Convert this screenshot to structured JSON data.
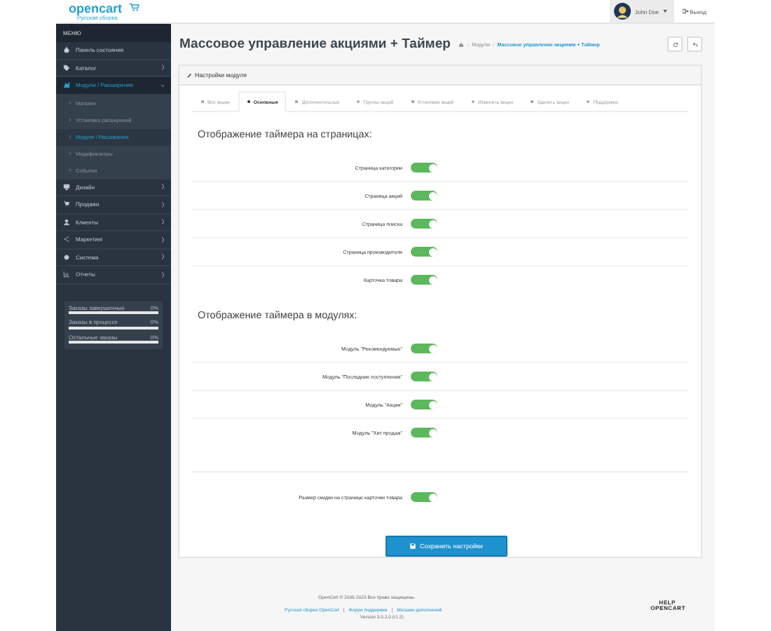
{
  "header": {
    "logo": "opencart",
    "logo_subtitle": "Русская сборка",
    "user": "John Doe",
    "logout": "Выход"
  },
  "sidebar": {
    "title": "МЕНЮ",
    "items": [
      {
        "label": "Панель состояния",
        "selected": false
      },
      {
        "label": "Каталог",
        "selected": false,
        "expanded": false
      },
      {
        "label": "Модули / Расширения",
        "selected": true,
        "expanded": true,
        "children": [
          {
            "label": "Магазин",
            "selected": false
          },
          {
            "label": "Установка расширений",
            "selected": false
          },
          {
            "label": "Модули / Расширения",
            "selected": true
          },
          {
            "label": "Модификаторы",
            "selected": false
          },
          {
            "label": "События",
            "selected": false
          }
        ]
      },
      {
        "label": "Дизайн",
        "selected": false,
        "expanded": false
      },
      {
        "label": "Продажи",
        "selected": false,
        "expanded": false
      },
      {
        "label": "Клиенты",
        "selected": false,
        "expanded": false
      },
      {
        "label": "Маркетинг",
        "selected": false,
        "expanded": false
      },
      {
        "label": "Система",
        "selected": false,
        "expanded": false
      },
      {
        "label": "Отчеты",
        "selected": false,
        "expanded": false
      }
    ],
    "stats": [
      {
        "label": "Заказы завершенные",
        "reading": "0%"
      },
      {
        "label": "Заказы в процессе",
        "reading": "0%"
      },
      {
        "label": "Остальные заказы",
        "reading": "0%"
      }
    ]
  },
  "page": {
    "title": "Массовое управление акциями + Таймер",
    "breadcrumbs": [
      "Модули",
      "Массовое управление акциями + Таймер"
    ],
    "breadcrumb_separator": "›"
  },
  "panel": {
    "title": "Настройки модуля",
    "tabs": [
      {
        "label": "Все акции",
        "selected": false
      },
      {
        "label": "Основные",
        "selected": true
      },
      {
        "label": "Дополнительные",
        "selected": false
      },
      {
        "label": "Группы акций",
        "selected": false
      },
      {
        "label": "Установка акций",
        "selected": false
      },
      {
        "label": "Изменить акции",
        "selected": false
      },
      {
        "label": "Удалить акции",
        "selected": false
      },
      {
        "label": "Поддержка",
        "selected": false
      }
    ],
    "sections": [
      {
        "heading": "Отображение таймера на страницах:",
        "rows": [
          {
            "label": "Страница категории",
            "on": true
          },
          {
            "label": "Страница акций",
            "on": true
          },
          {
            "label": "Страница поиска",
            "on": true
          },
          {
            "label": "Страница производителя",
            "on": true
          },
          {
            "label": "Карточка товара",
            "on": true
          }
        ]
      },
      {
        "heading": "Отображение таймера в модулях:",
        "rows": [
          {
            "label": "Модуль \"Рекомендуемые\"",
            "on": true
          },
          {
            "label": "Модуль \"Последние поступления\"",
            "on": true
          },
          {
            "label": "Модуль \"Акции\"",
            "on": true
          },
          {
            "label": "Модуль \"Хит продаж\"",
            "on": true
          }
        ]
      },
      {
        "rows": [
          {
            "label": "Размер скидки на странице карточки товара",
            "on": true
          }
        ]
      }
    ],
    "save_button": "Сохранить настройки"
  },
  "footer": {
    "copyright": "OpenCart © 2009-2023 Все права защищены.",
    "links": [
      "Русская сборка OpenCart",
      "Форум поддержки",
      "Магазин дополнений"
    ],
    "separator": "|",
    "version": "Version 3.0.2.0 (r1.2)",
    "badge_top": "HELP",
    "badge_bottom": "OPENCART"
  }
}
